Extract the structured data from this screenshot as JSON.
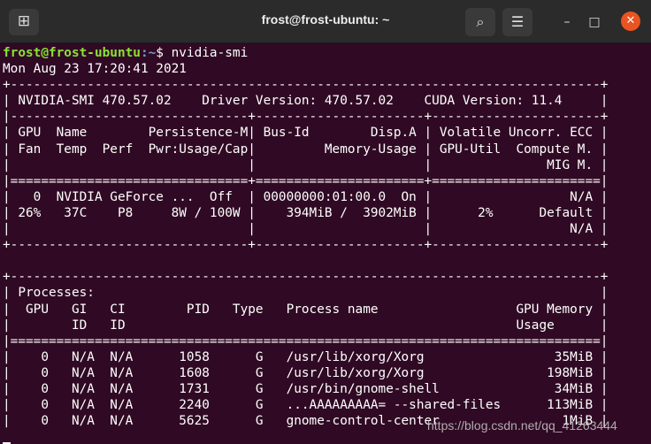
{
  "window": {
    "title": "frost@frost-ubuntu: ~",
    "new_tab_glyph": "⊞",
    "search_glyph": "⌕",
    "menu_glyph": "☰",
    "minimize_glyph": "–",
    "maximize_glyph": "□",
    "close_glyph": "✕"
  },
  "prompt": {
    "user_host": "frost@frost-ubuntu",
    "path": ":~",
    "command": "$ nvidia-smi"
  },
  "output_lines": [
    "Mon Aug 23 17:20:41 2021",
    "+-----------------------------------------------------------------------------+",
    "| NVIDIA-SMI 470.57.02    Driver Version: 470.57.02    CUDA Version: 11.4     |",
    "|-------------------------------+----------------------+----------------------+",
    "| GPU  Name        Persistence-M| Bus-Id        Disp.A | Volatile Uncorr. ECC |",
    "| Fan  Temp  Perf  Pwr:Usage/Cap|         Memory-Usage | GPU-Util  Compute M. |",
    "|                               |                      |               MIG M. |",
    "|===============================+======================+======================|",
    "|   0  NVIDIA GeForce ...  Off  | 00000000:01:00.0  On |                  N/A |",
    "| 26%   37C    P8     8W / 100W |    394MiB /  3902MiB |      2%      Default |",
    "|                               |                      |                  N/A |",
    "+-------------------------------+----------------------+----------------------+",
    "",
    "+-----------------------------------------------------------------------------+",
    "| Processes:                                                                  |",
    "|  GPU   GI   CI        PID   Type   Process name                  GPU Memory |",
    "|        ID   ID                                                   Usage      |",
    "|=============================================================================|",
    "|    0   N/A  N/A      1058      G   /usr/lib/xorg/Xorg                 35MiB |",
    "|    0   N/A  N/A      1608      G   /usr/lib/xorg/Xorg                198MiB |",
    "|    0   N/A  N/A      1731      G   /usr/bin/gnome-shell               34MiB |",
    "|    0   N/A  N/A      2240      G   ...AAAAAAAAA= --shared-files      113MiB |",
    "|    0   N/A  N/A      5625      G   gnome-control-center                1MiB |"
  ],
  "watermark": "https://blog.csdn.net/qq_41263444"
}
